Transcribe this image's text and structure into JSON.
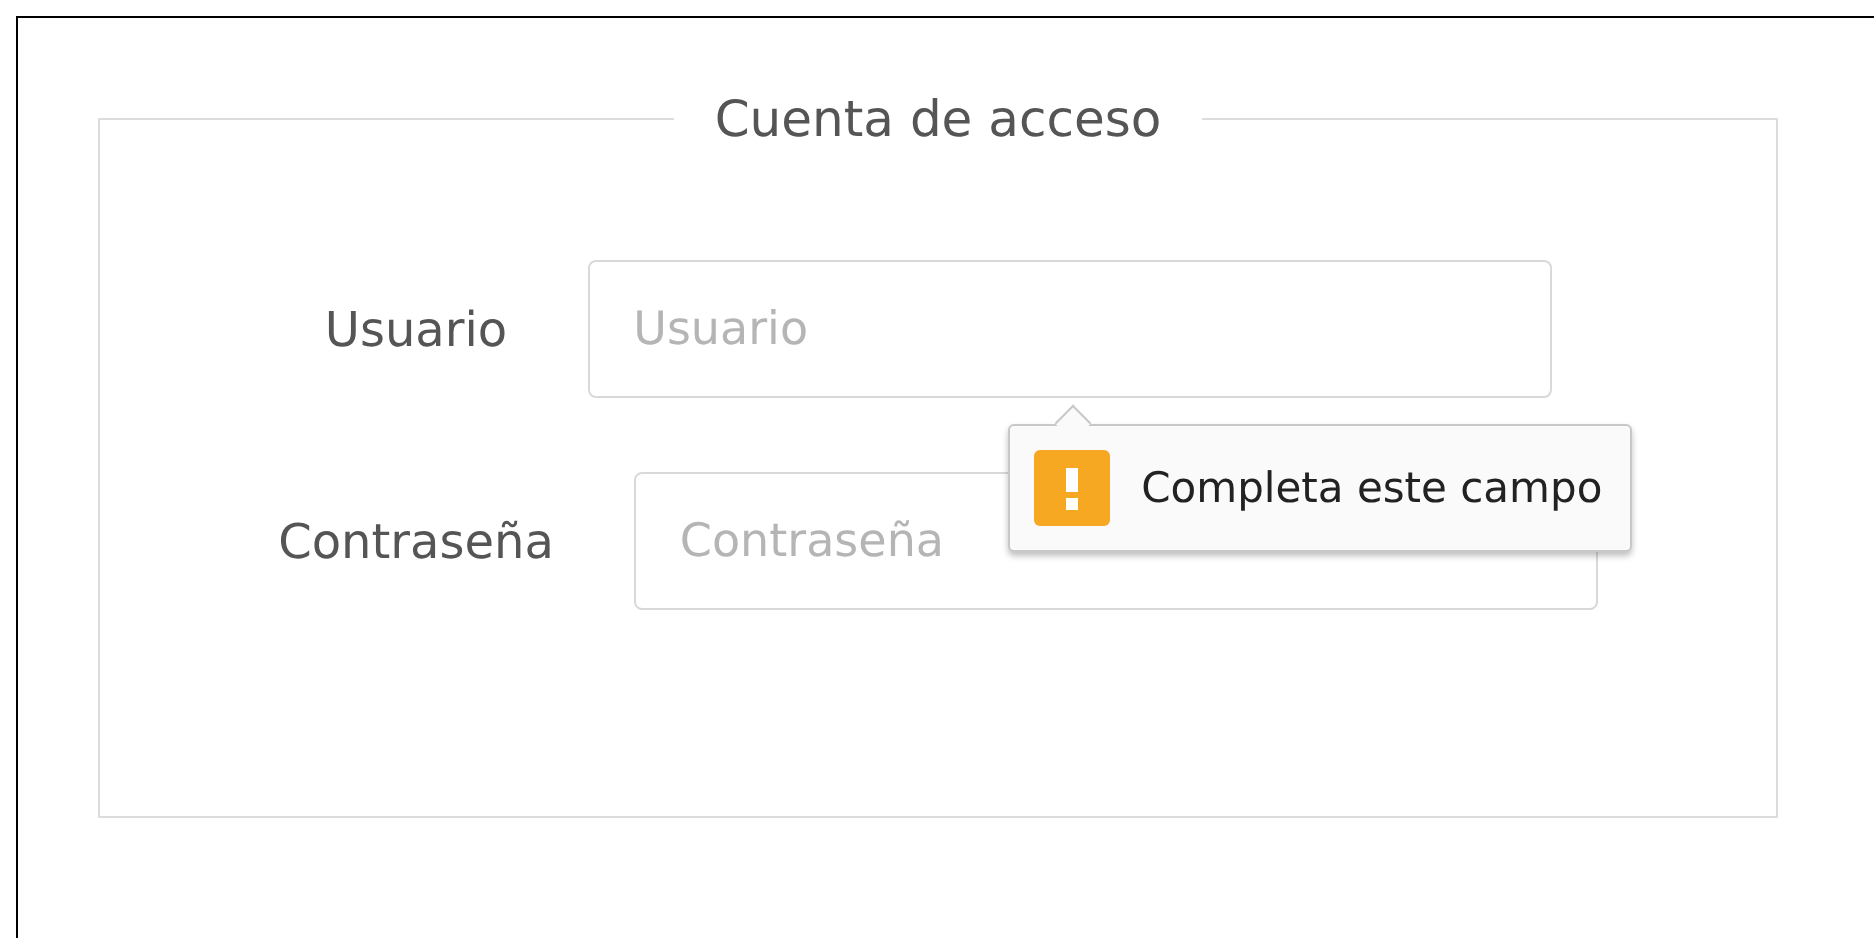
{
  "fieldset": {
    "legend": "Cuenta de acceso",
    "fields": [
      {
        "label": "Usuario",
        "placeholder": "Usuario",
        "tooltip": "Completa este campo"
      },
      {
        "label": "Contraseña",
        "placeholder": "Contraseña"
      }
    ]
  }
}
